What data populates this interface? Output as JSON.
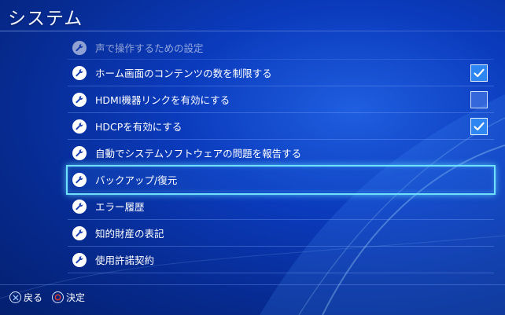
{
  "header": {
    "title": "システム"
  },
  "menu": {
    "items": [
      {
        "label": "声で操作するための設定",
        "checkbox": null
      },
      {
        "label": "ホーム画面のコンテンツの数を制限する",
        "checkbox": true
      },
      {
        "label": "HDMI機器リンクを有効にする",
        "checkbox": false
      },
      {
        "label": "HDCPを有効にする",
        "checkbox": true
      },
      {
        "label": "自動でシステムソフトウェアの問題を報告する",
        "checkbox": null
      },
      {
        "label": "バックアップ/復元",
        "checkbox": null,
        "selected": true
      },
      {
        "label": "エラー履歴",
        "checkbox": null
      },
      {
        "label": "知的財産の表記",
        "checkbox": null
      },
      {
        "label": "使用許諾契約",
        "checkbox": null
      }
    ]
  },
  "footer": {
    "back_label": "戻る",
    "confirm_label": "決定",
    "back_icon": "cross-button-icon",
    "confirm_icon": "circle-button-icon"
  },
  "colors": {
    "background": "#0b3bbd",
    "selection_glow": "#6fe0ff",
    "checkbox_on": "#2e86f2",
    "confirm_circle": "#e23b2e"
  }
}
